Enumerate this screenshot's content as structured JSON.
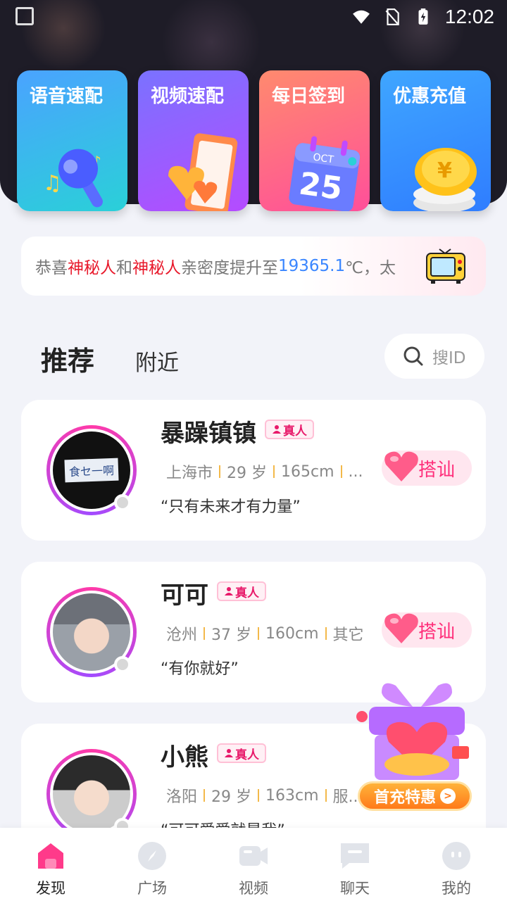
{
  "status_bar": {
    "time": "12:02"
  },
  "quick_actions": [
    {
      "label": "语音速配",
      "icon": "microphone-icon"
    },
    {
      "label": "视频速配",
      "icon": "phone-heart-icon"
    },
    {
      "label": "每日签到",
      "icon": "calendar-icon",
      "calendar_month": "OCT",
      "calendar_day": "25"
    },
    {
      "label": "优惠充值",
      "icon": "coin-icon"
    }
  ],
  "notice": {
    "prefix": "恭喜",
    "user_a": "神秘人",
    "mid": "和",
    "user_b": "神秘人",
    "action": "亲密度提升至",
    "value": "19365.1",
    "suffix": "℃，太"
  },
  "tabs": {
    "recommend": "推荐",
    "nearby": "附近"
  },
  "search": {
    "placeholder": "搜ID"
  },
  "real_badge": "真人",
  "chat_button": "搭讪",
  "users": [
    {
      "name": "暴躁镇镇",
      "city": "上海市",
      "age": "29 岁",
      "height": "165cm",
      "extra": "...",
      "quote": "“只有未来才有力量”",
      "avatar_text": "食セ一啊"
    },
    {
      "name": "可可",
      "city": "沧州",
      "age": "37 岁",
      "height": "160cm",
      "extra": "其它",
      "quote": "“有你就好”"
    },
    {
      "name": "小熊",
      "city": "洛阳",
      "age": "29 岁",
      "height": "163cm",
      "extra": "服...",
      "quote": "“可可爱爱就是我”"
    }
  ],
  "promo": {
    "label": "首充特惠"
  },
  "bottom_nav": [
    {
      "label": "发现",
      "icon": "discover-home-icon",
      "active": true
    },
    {
      "label": "广场",
      "icon": "compass-icon",
      "active": false
    },
    {
      "label": "视频",
      "icon": "video-camera-icon",
      "active": false
    },
    {
      "label": "聊天",
      "icon": "chat-bubble-icon",
      "active": false
    },
    {
      "label": "我的",
      "icon": "profile-face-icon",
      "active": false
    }
  ]
}
